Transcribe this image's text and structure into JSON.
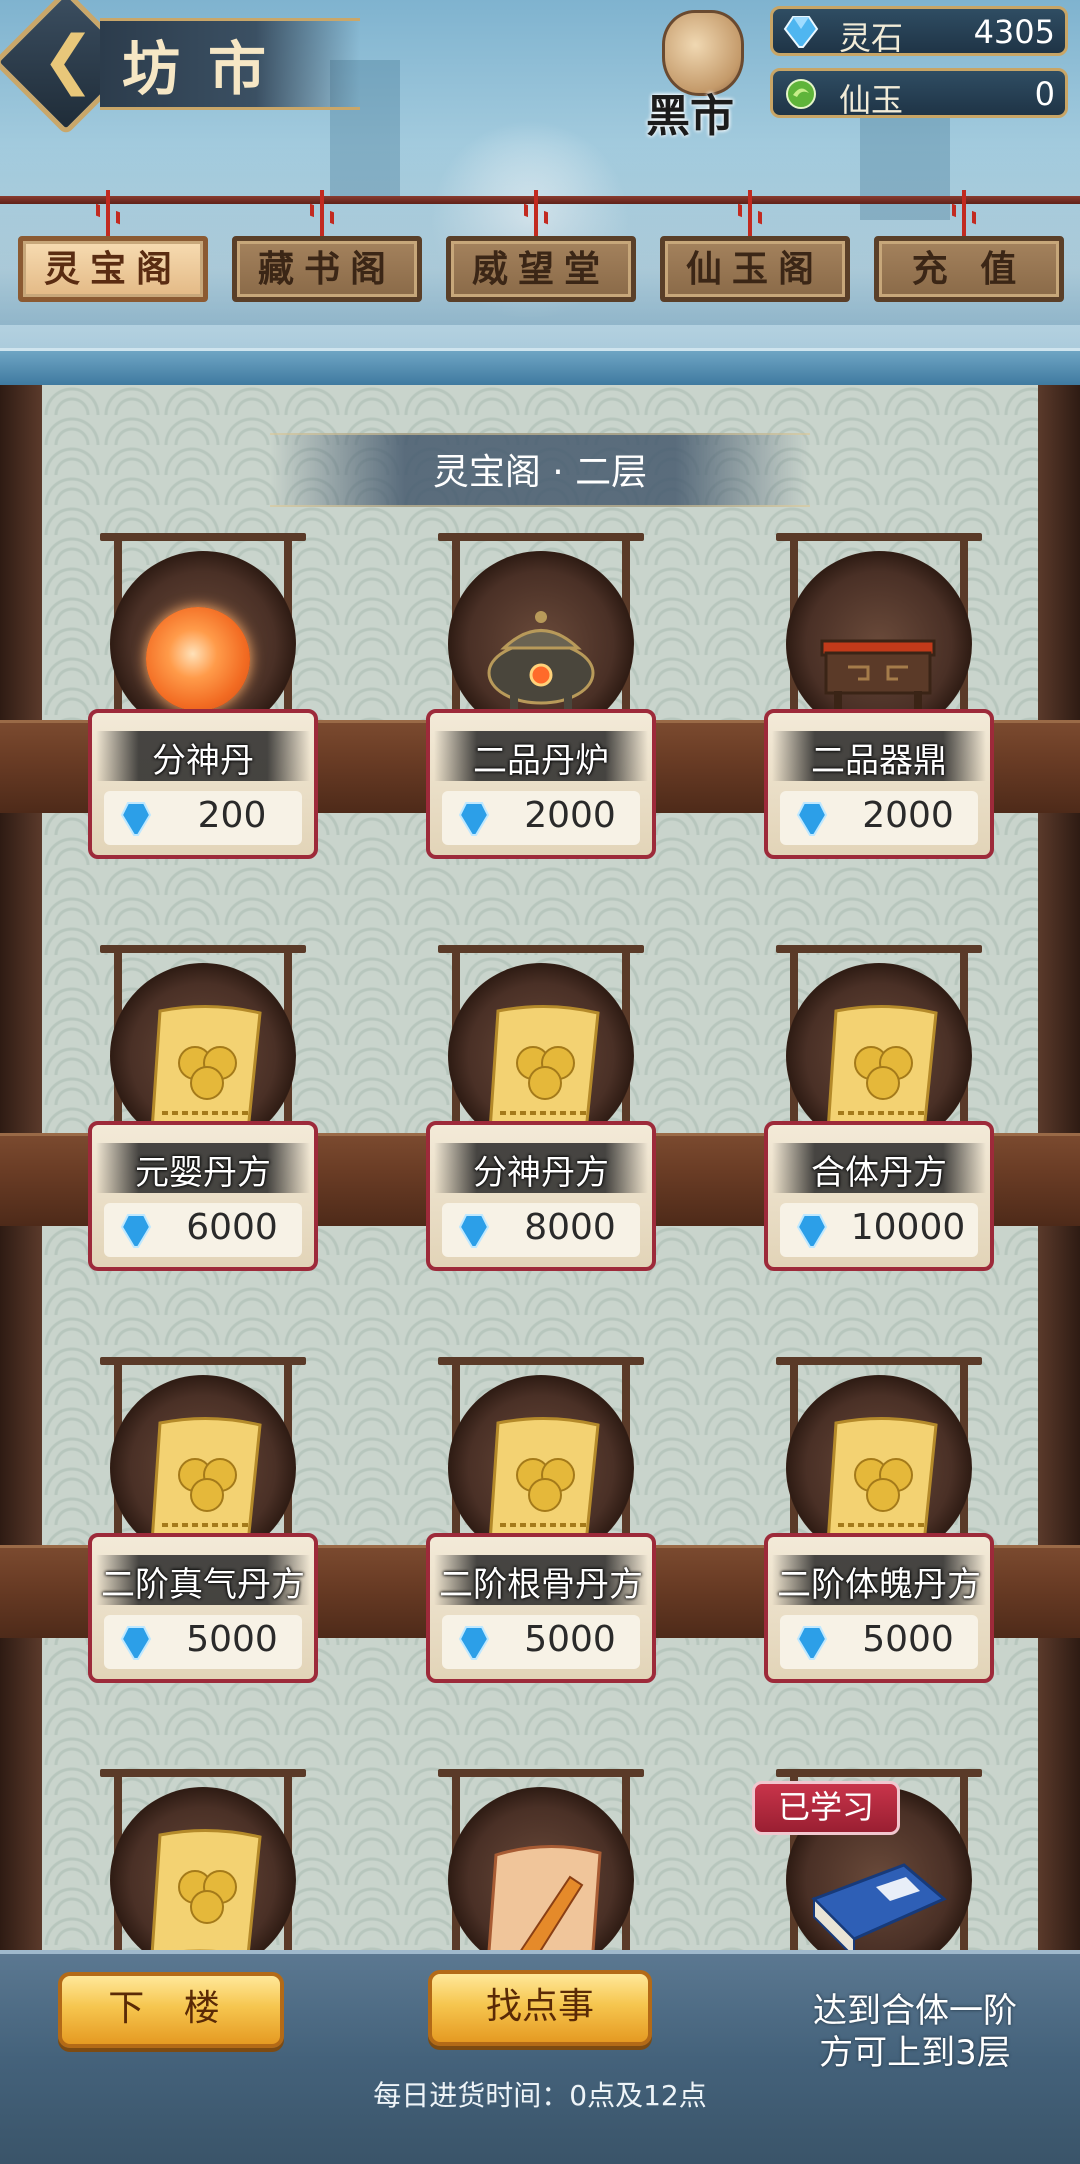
{
  "header": {
    "title": "坊市",
    "black_market": "黑市",
    "currencies": [
      {
        "name": "灵石",
        "value": "4305",
        "icon": "blue-gem-icon"
      },
      {
        "name": "仙玉",
        "value": "0",
        "icon": "green-jade-icon"
      }
    ]
  },
  "tabs": [
    {
      "label": "灵宝阁",
      "active": true
    },
    {
      "label": "藏书阁",
      "active": false
    },
    {
      "label": "威望堂",
      "active": false
    },
    {
      "label": "仙玉阁",
      "active": false
    },
    {
      "label": "充 值",
      "active": false
    }
  ],
  "floor": {
    "title": "灵宝阁 · 二层"
  },
  "items": [
    {
      "name": "分神丹",
      "price": "200",
      "art": "orange-orb"
    },
    {
      "name": "二品丹炉",
      "price": "2000",
      "art": "furnace"
    },
    {
      "name": "二品器鼎",
      "price": "2000",
      "art": "cauldron"
    },
    {
      "name": "元婴丹方",
      "price": "6000",
      "art": "recipe-scroll"
    },
    {
      "name": "分神丹方",
      "price": "8000",
      "art": "recipe-scroll"
    },
    {
      "name": "合体丹方",
      "price": "10000",
      "art": "recipe-scroll"
    },
    {
      "name": "二阶真气丹方",
      "price": "5000",
      "art": "recipe-scroll"
    },
    {
      "name": "二阶根骨丹方",
      "price": "5000",
      "art": "recipe-scroll"
    },
    {
      "name": "二阶体魄丹方",
      "price": "5000",
      "art": "recipe-scroll"
    },
    {
      "name": "",
      "price": "",
      "art": "recipe-scroll"
    },
    {
      "name": "",
      "price": "",
      "art": "weapon-scroll"
    },
    {
      "name": "",
      "price": "",
      "art": "blue-book",
      "badge": "已学习"
    }
  ],
  "bottom": {
    "downstairs": "下 楼",
    "find_task": "找点事",
    "tip": "达到合体一阶方可上到3层",
    "tip_line1": "达到合体一阶",
    "tip_line2": "方可上到3层",
    "restock": "每日进货时间：0点及12点"
  }
}
